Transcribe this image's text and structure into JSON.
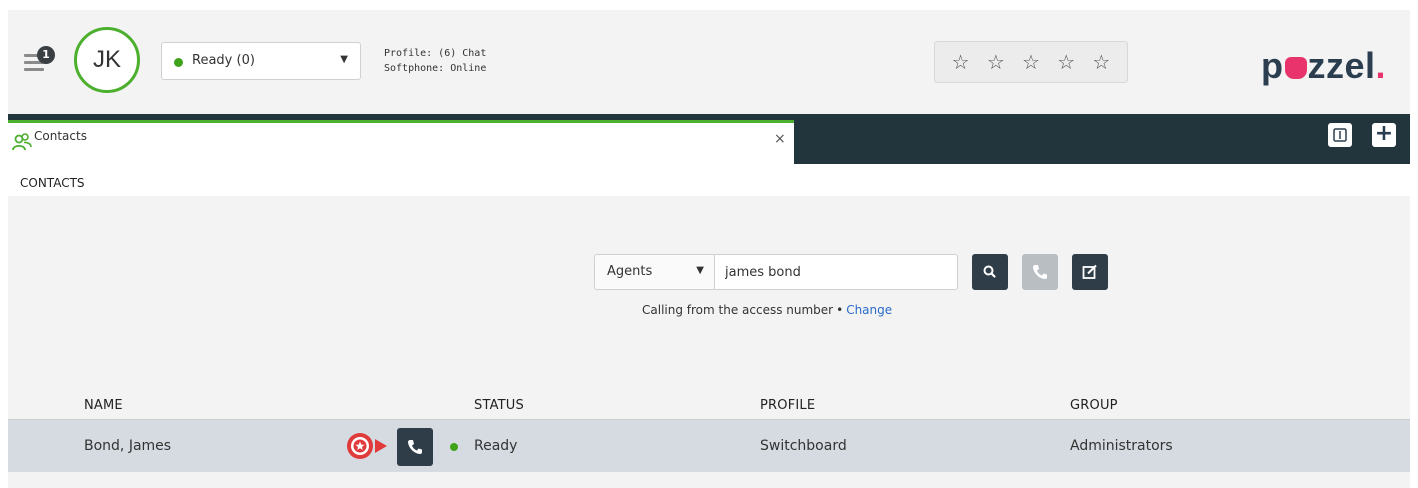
{
  "header": {
    "notification_count": "1",
    "avatar_initials": "JK",
    "status": {
      "label": "Ready (0)",
      "color": "#3fa31a"
    },
    "profile_line": "Profile: (6) Chat",
    "softphone_line": "Softphone: Online",
    "rating_stars": [
      "star-outline-icon",
      "star-outline-icon",
      "star-outline-icon",
      "star-outline-icon",
      "star-outline-icon"
    ],
    "logo": {
      "text_before": "p",
      "text_after": "zzel",
      "dot": ".",
      "accent_color": "#e8336d"
    }
  },
  "tabs": {
    "active_label": "Contacts",
    "close_glyph": "×",
    "add_glyph": "+"
  },
  "contacts": {
    "section_title": "CONTACTS",
    "search": {
      "type_selected": "Agents",
      "query": "james bond"
    },
    "calling_note": "Calling from the access number",
    "calling_separator": "•",
    "change_link": "Change",
    "columns": [
      "NAME",
      "STATUS",
      "PROFILE",
      "GROUP"
    ],
    "rows": [
      {
        "name": "Bond, James",
        "status": "Ready",
        "status_color": "#3fa31a",
        "profile": "Switchboard",
        "group": "Administrators"
      }
    ]
  }
}
